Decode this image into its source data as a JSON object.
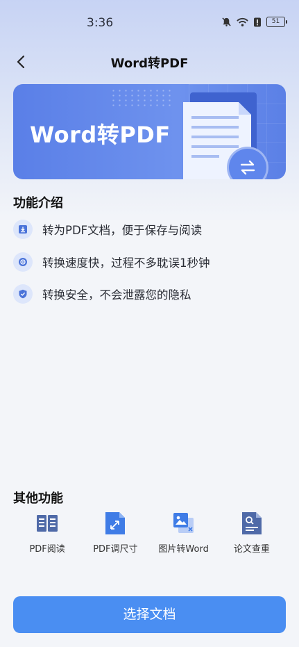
{
  "status_bar": {
    "time": "3:36",
    "battery": "51"
  },
  "header": {
    "title": "Word转PDF"
  },
  "banner": {
    "text": "Word转PDF"
  },
  "features": {
    "title": "功能介绍",
    "items": [
      {
        "icon": "download-icon",
        "text": "转为PDF文档，便于保存与阅读"
      },
      {
        "icon": "speed-icon",
        "text": "转换速度快，过程不多耽误1秒钟"
      },
      {
        "icon": "shield-icon",
        "text": "转换安全，不会泄露您的隐私"
      }
    ]
  },
  "other_functions": {
    "title": "其他功能",
    "items": [
      {
        "icon": "book-icon",
        "label": "PDF阅读"
      },
      {
        "icon": "resize-icon",
        "label": "PDF调尺寸"
      },
      {
        "icon": "image-to-word-icon",
        "label": "图片转Word"
      },
      {
        "icon": "paper-check-icon",
        "label": "论文查重"
      }
    ]
  },
  "primary_button": {
    "label": "选择文档"
  },
  "colors": {
    "accent": "#4a8ef2",
    "banner": "#5a7fe7",
    "icon": "#4a73d9"
  }
}
